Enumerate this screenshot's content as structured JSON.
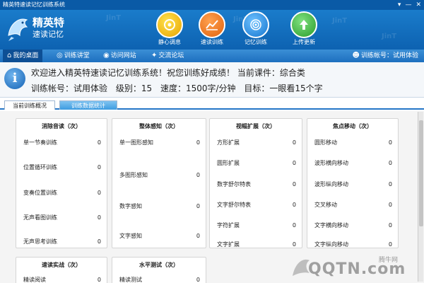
{
  "window": {
    "title": "精英特速读记忆训练系统",
    "controls": [
      "▾",
      "—",
      "✕"
    ]
  },
  "brand": {
    "name": "精英特",
    "sub": "速读记忆"
  },
  "toolbar": [
    {
      "label": "静心调息",
      "icon": "meditation-icon",
      "color": "#f2b705"
    },
    {
      "label": "速读训练",
      "icon": "chart-icon",
      "color": "#f07a1a"
    },
    {
      "label": "记忆训练",
      "icon": "memory-icon",
      "color": "#1e8fe0"
    },
    {
      "label": "上传更新",
      "icon": "upload-icon",
      "color": "#3ab43a"
    }
  ],
  "nav": [
    {
      "label": "我的桌面",
      "active": true
    },
    {
      "label": "训练讲堂"
    },
    {
      "label": "访问网站"
    },
    {
      "label": "交流论坛"
    }
  ],
  "account_nav": "训练帐号：试用体验",
  "welcome": {
    "line1": "欢迎进入精英特速读记忆训练系统！祝您训练好成绩！   当前课件：综合类",
    "account": "训练帐号：试用体验",
    "level": "级别：15",
    "speed": "速度：1500字/分钟",
    "target": "目标：一眼看15个字"
  },
  "tabs": {
    "current": "当前训练概况",
    "stats": "训练数据统计"
  },
  "panels": [
    {
      "title": "消除音读（次）",
      "rows": [
        {
          "label": "单一节奏训练",
          "value": "0"
        },
        {
          "label": "位置循环训练",
          "value": "0"
        },
        {
          "label": "变奏位置训练",
          "value": "0"
        },
        {
          "label": "无声看图训练",
          "value": "0"
        },
        {
          "label": "无声思考训练",
          "value": "0"
        }
      ]
    },
    {
      "title": "整体感知（次）",
      "rows": [
        {
          "label": "单一图形感知",
          "value": "0"
        },
        {
          "label": "多图形感知",
          "value": "0"
        },
        {
          "label": "数字感知",
          "value": "0"
        },
        {
          "label": "文字感知",
          "value": "0"
        }
      ]
    },
    {
      "title": "视幅扩展（次）",
      "rows": [
        {
          "label": "方形扩展",
          "value": "0"
        },
        {
          "label": "圆形扩展",
          "value": "0"
        },
        {
          "label": "数字舒尔特表",
          "value": "0"
        },
        {
          "label": "文字舒尔特表",
          "value": "0"
        },
        {
          "label": "字符扩展",
          "value": "0"
        },
        {
          "label": "文字扩展",
          "value": "0"
        }
      ]
    },
    {
      "title": "焦点移动（次）",
      "rows": [
        {
          "label": "圆形移动",
          "value": "0"
        },
        {
          "label": "波形横向移动",
          "value": "0"
        },
        {
          "label": "波形纵向移动",
          "value": "0"
        },
        {
          "label": "交叉移动",
          "value": "0"
        },
        {
          "label": "文字横向移动",
          "value": "0"
        },
        {
          "label": "文字纵向移动",
          "value": "0"
        }
      ]
    },
    {
      "title": "速读实战（次）",
      "rows": [
        {
          "label": "精读阅读",
          "value": "0"
        }
      ]
    },
    {
      "title": "水平测试（次）",
      "rows": [
        {
          "label": "精读测试",
          "value": "0"
        }
      ]
    }
  ],
  "watermark": {
    "brand": "QQTN.com",
    "site": "腾牛网"
  }
}
